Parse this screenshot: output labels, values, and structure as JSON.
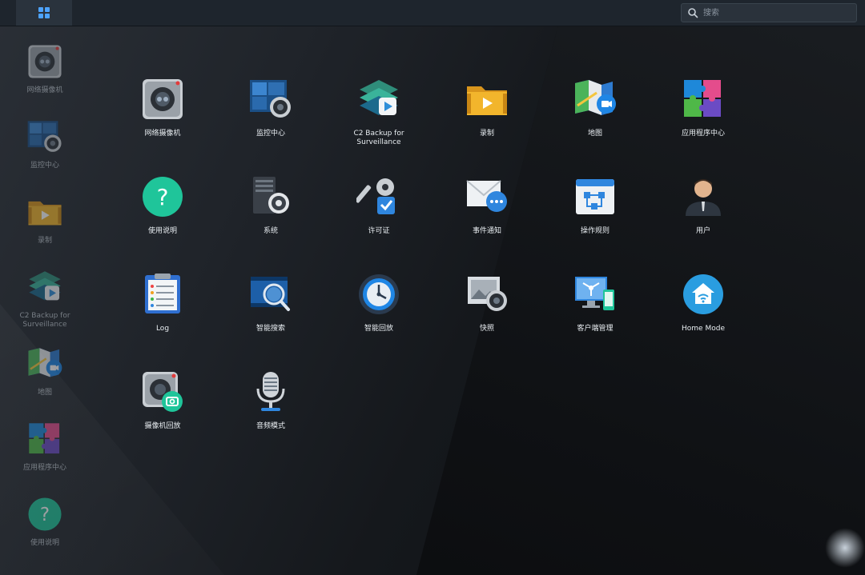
{
  "topbar": {
    "search_placeholder": "搜索"
  },
  "sidebar": {
    "items": [
      {
        "label": "网络摄像机",
        "icon": "ip-camera-icon"
      },
      {
        "label": "监控中心",
        "icon": "monitor-center-icon"
      },
      {
        "label": "录制",
        "icon": "recording-icon"
      },
      {
        "label": "C2 Backup for Surveillance",
        "icon": "c2-backup-icon"
      },
      {
        "label": "地图",
        "icon": "map-icon"
      },
      {
        "label": "应用程序中心",
        "icon": "package-center-icon"
      },
      {
        "label": "使用说明",
        "icon": "help-icon"
      }
    ]
  },
  "apps": [
    {
      "label": "网络摄像机",
      "icon": "ip-camera-icon"
    },
    {
      "label": "监控中心",
      "icon": "monitor-center-icon"
    },
    {
      "label": "C2 Backup for Surveillance",
      "icon": "c2-backup-icon"
    },
    {
      "label": "录制",
      "icon": "recording-icon"
    },
    {
      "label": "地图",
      "icon": "map-icon"
    },
    {
      "label": "应用程序中心",
      "icon": "package-center-icon"
    },
    {
      "label": "使用说明",
      "icon": "help-icon"
    },
    {
      "label": "系统",
      "icon": "system-gear-icon"
    },
    {
      "label": "许可证",
      "icon": "license-key-icon"
    },
    {
      "label": "事件通知",
      "icon": "notification-icon"
    },
    {
      "label": "操作规则",
      "icon": "action-rule-icon"
    },
    {
      "label": "用户",
      "icon": "user-icon"
    },
    {
      "label": "Log",
      "icon": "log-icon"
    },
    {
      "label": "智能搜索",
      "icon": "smart-search-icon"
    },
    {
      "label": "智能回放",
      "icon": "smart-playback-icon"
    },
    {
      "label": "快照",
      "icon": "snapshot-icon"
    },
    {
      "label": "客户端管理",
      "icon": "client-management-icon"
    },
    {
      "label": "Home Mode",
      "icon": "home-mode-icon"
    },
    {
      "label": "摄像机回放",
      "icon": "camera-snapshot-icon"
    },
    {
      "label": "音频模式",
      "icon": "audio-mic-icon"
    }
  ],
  "colors": {
    "accent": "#4da3ff",
    "topbar": "#1e252d",
    "help_green": "#1fc59a",
    "home_blue": "#2a9de0"
  }
}
